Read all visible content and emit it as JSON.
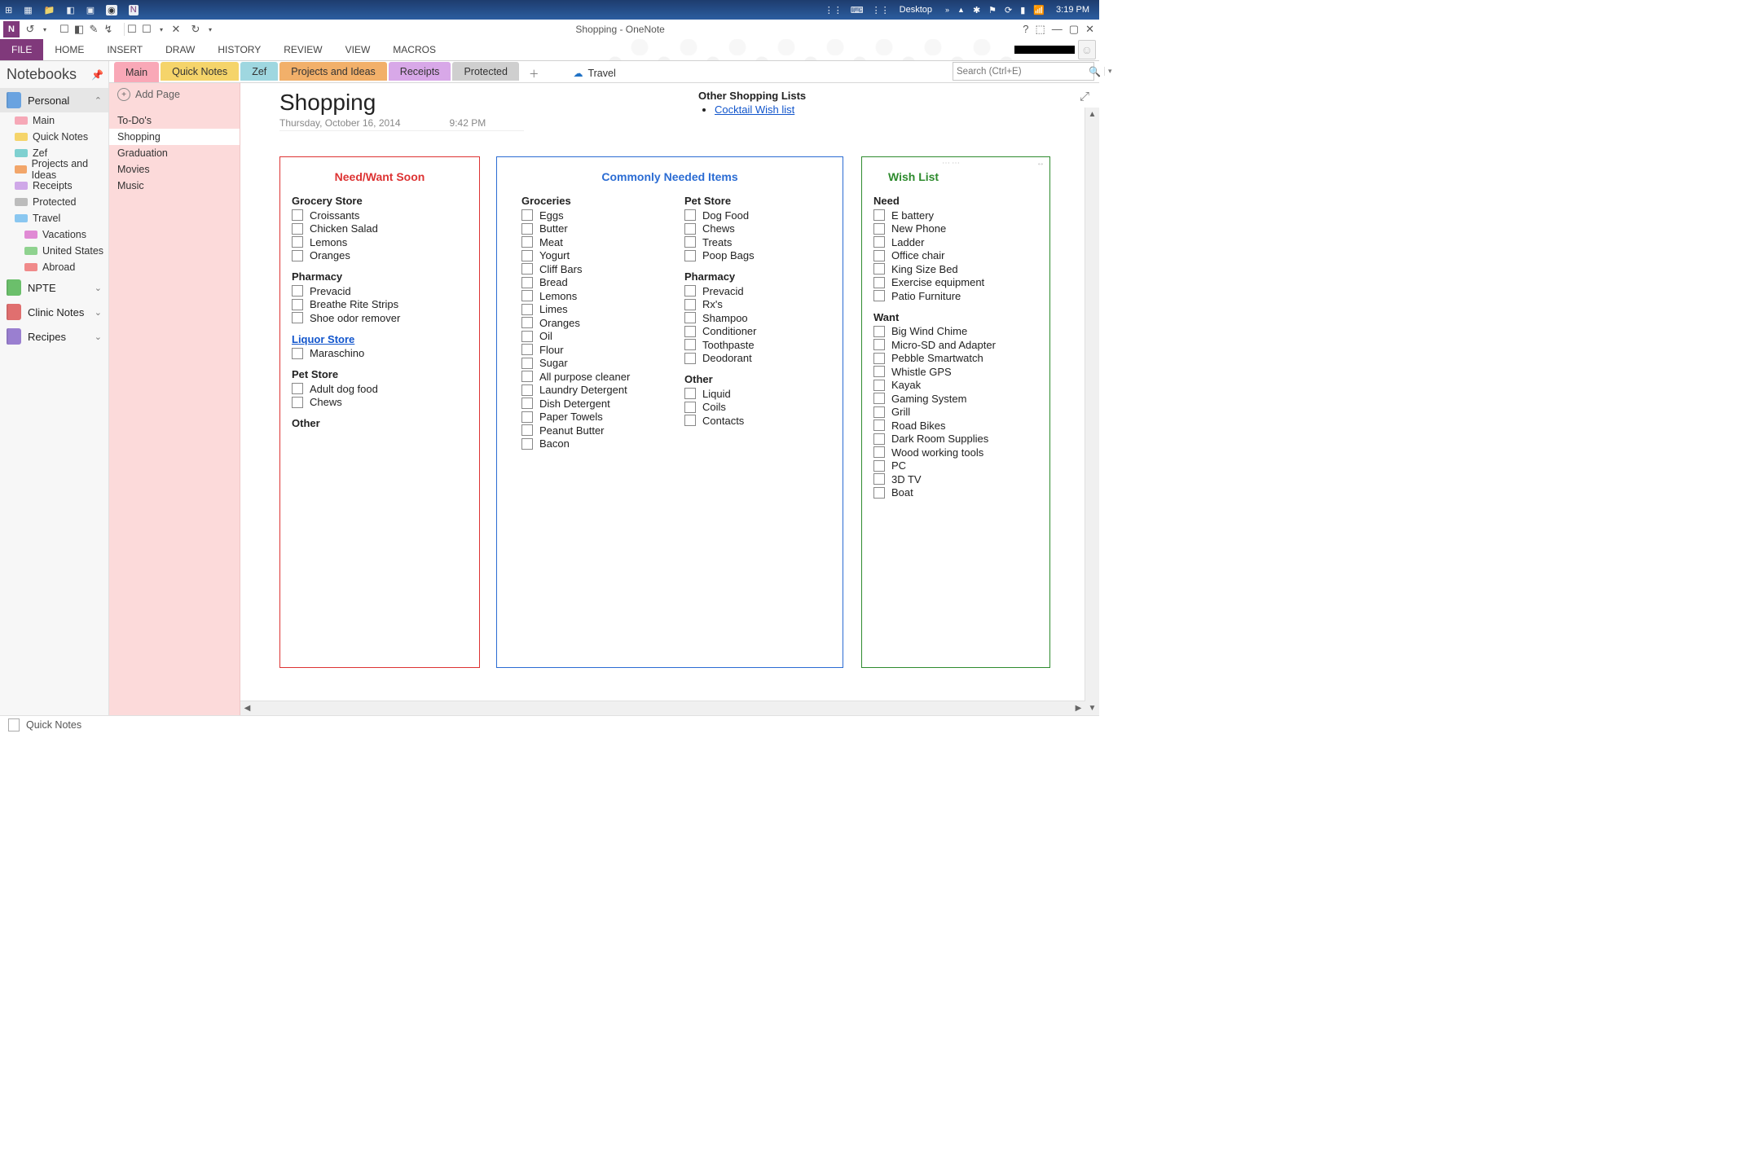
{
  "taskbar": {
    "desktop": "Desktop",
    "clock": "3:19 PM"
  },
  "window": {
    "title": "Shopping - OneNote"
  },
  "ribbon": {
    "file": "FILE",
    "tabs": [
      "HOME",
      "INSERT",
      "DRAW",
      "HISTORY",
      "REVIEW",
      "VIEW",
      "MACROS"
    ]
  },
  "notebooks": {
    "header": "Notebooks",
    "books": [
      {
        "name": "Personal",
        "color": "b-blue",
        "expanded": true,
        "selected": true,
        "sections": [
          {
            "name": "Main",
            "swatch": "sw-pink"
          },
          {
            "name": "Quick Notes",
            "swatch": "sw-yellow"
          },
          {
            "name": "Zef",
            "swatch": "sw-teal"
          },
          {
            "name": "Projects and Ideas",
            "swatch": "sw-orange"
          },
          {
            "name": "Receipts",
            "swatch": "sw-lav"
          },
          {
            "name": "Protected",
            "swatch": "sw-gray"
          },
          {
            "name": "Travel",
            "swatch": "sw-sky",
            "subs": [
              {
                "name": "Vacations",
                "swatch": "sw-mag"
              },
              {
                "name": "United States",
                "swatch": "sw-green"
              },
              {
                "name": "Abroad",
                "swatch": "sw-red"
              }
            ]
          }
        ]
      },
      {
        "name": "NPTE",
        "color": "b-green"
      },
      {
        "name": "Clinic Notes",
        "color": "b-red"
      },
      {
        "name": "Recipes",
        "color": "b-purple"
      }
    ]
  },
  "section_tabs": [
    {
      "label": "Main",
      "color": "#f9a8b7",
      "active": true
    },
    {
      "label": "Quick Notes",
      "color": "#f5d46a"
    },
    {
      "label": "Zef",
      "color": "#9fd7e0"
    },
    {
      "label": "Projects and Ideas",
      "color": "#f2b06a"
    },
    {
      "label": "Receipts",
      "color": "#d8a8e8"
    },
    {
      "label": "Protected",
      "color": "#cfcfcf"
    }
  ],
  "linked_section": "Travel",
  "search": {
    "placeholder": "Search (Ctrl+E)"
  },
  "pages": {
    "add": "Add Page",
    "items": [
      "To-Do's",
      "Shopping",
      "Graduation",
      "Movies",
      "Music"
    ],
    "selected": "Shopping"
  },
  "page": {
    "title": "Shopping",
    "date": "Thursday, October 16, 2014",
    "time": "9:42 PM",
    "other_header": "Other Shopping Lists",
    "other_link": "Cocktail Wish list"
  },
  "box_need": {
    "title": "Need/Want Soon",
    "groups": [
      {
        "header": "Grocery Store",
        "items": [
          "Croissants",
          "Chicken Salad",
          "Lemons",
          "Oranges"
        ]
      },
      {
        "header": "Pharmacy",
        "items": [
          "Prevacid",
          "Breathe Rite Strips",
          "Shoe odor remover"
        ]
      },
      {
        "header": "Liquor Store",
        "link": true,
        "items": [
          "Maraschino"
        ]
      },
      {
        "header": "Pet Store",
        "items": [
          "Adult dog food",
          "Chews"
        ]
      },
      {
        "header": "Other",
        "items": []
      }
    ]
  },
  "box_common": {
    "title": "Commonly Needed Items",
    "left": [
      {
        "header": "Groceries",
        "items": [
          "Eggs",
          "Butter",
          "Meat",
          "Yogurt",
          "Cliff Bars",
          "Bread",
          "Lemons",
          "Limes",
          "Oranges",
          "Oil",
          "Flour",
          "Sugar",
          "All purpose cleaner",
          "Laundry Detergent",
          "Dish Detergent",
          "Paper Towels",
          "Peanut Butter",
          "Bacon"
        ]
      }
    ],
    "right": [
      {
        "header": "Pet Store",
        "items": [
          "Dog Food",
          "Chews",
          "Treats",
          "Poop Bags"
        ]
      },
      {
        "header": "Pharmacy",
        "items": [
          "Prevacid",
          "Rx's",
          "Shampoo",
          "Conditioner",
          "Toothpaste",
          "Deodorant"
        ]
      },
      {
        "header": "Other",
        "items": [
          "Liquid",
          "Coils",
          "Contacts"
        ]
      }
    ]
  },
  "box_wish": {
    "title": "Wish List",
    "groups": [
      {
        "header": "Need",
        "items": [
          "E battery",
          "New Phone",
          "Ladder",
          "Office chair",
          "King Size Bed",
          "Exercise equipment",
          "Patio Furniture"
        ]
      },
      {
        "header": "Want",
        "items": [
          "Big Wind Chime",
          "Micro-SD and Adapter",
          "Pebble Smartwatch",
          "Whistle GPS",
          "Kayak",
          "Gaming System",
          "Grill",
          "Road Bikes",
          "Dark Room Supplies",
          "Wood working tools",
          "PC",
          "3D TV",
          "Boat"
        ]
      }
    ]
  },
  "statusbar": {
    "quicknotes": "Quick Notes"
  }
}
